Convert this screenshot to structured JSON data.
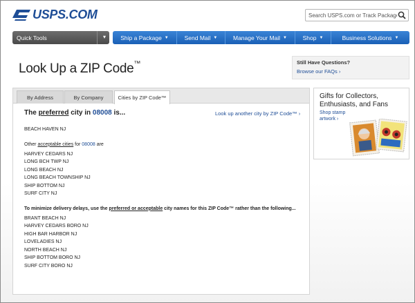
{
  "header": {
    "logo_text": "USPS.COM",
    "search_placeholder": "Search USPS.com or Track Packages"
  },
  "nav": {
    "quick_tools": "Quick Tools",
    "items": [
      {
        "label": "Ship a Package"
      },
      {
        "label": "Send Mail"
      },
      {
        "label": "Manage Your Mail"
      },
      {
        "label": "Shop"
      },
      {
        "label": "Business Solutions"
      }
    ]
  },
  "page": {
    "title": "Look Up a ZIP Code",
    "title_tm": "™"
  },
  "help": {
    "title": "Still Have Questions?",
    "link": "Browse our FAQs ›"
  },
  "tabs": [
    {
      "label": "By Address"
    },
    {
      "label": "By Company"
    },
    {
      "label": "Cities by ZIP Code™"
    }
  ],
  "results": {
    "preferred_prefix": "The ",
    "preferred_word": "preferred",
    "preferred_mid": " city in ",
    "zip": "08008",
    "preferred_suffix": " is...",
    "lookup_link": "Look up another city by ZIP Code™ ›",
    "preferred_city": "BEACH HAVEN NJ",
    "acceptable_prefix": "Other ",
    "acceptable_word": "acceptable cities",
    "acceptable_mid": " for ",
    "acceptable_suffix": " are",
    "acceptable_cities": [
      "HARVEY CEDARS NJ",
      "LONG BCH TWP NJ",
      "LONG BEACH NJ",
      "LONG BEACH TOWNSHIP NJ",
      "SHIP BOTTOM NJ",
      "SURF CITY NJ"
    ],
    "avoid_prefix": "To minimize delivery delays, use the ",
    "avoid_word": "preferred or acceptable",
    "avoid_suffix": " city names for this ZIP Code™ rather than the following...",
    "avoid_cities": [
      "BRANT BEACH NJ",
      "HARVEY CEDARS BORO NJ",
      "HIGH BAR HARBOR NJ",
      "LOVELADIES NJ",
      "NORTH BEACH NJ",
      "SHIP BOTTOM BORO NJ",
      "SURF CITY BORO NJ"
    ]
  },
  "promo": {
    "title": "Gifts for Collectors, Enthusiasts, and Fans",
    "link_line1": "Shop stamp",
    "link_line2": "artwork ›"
  },
  "colors": {
    "brand_blue": "#1e4d96",
    "nav_blue": "#2a72c8",
    "quick_tools_gray": "#5a5a5a"
  }
}
